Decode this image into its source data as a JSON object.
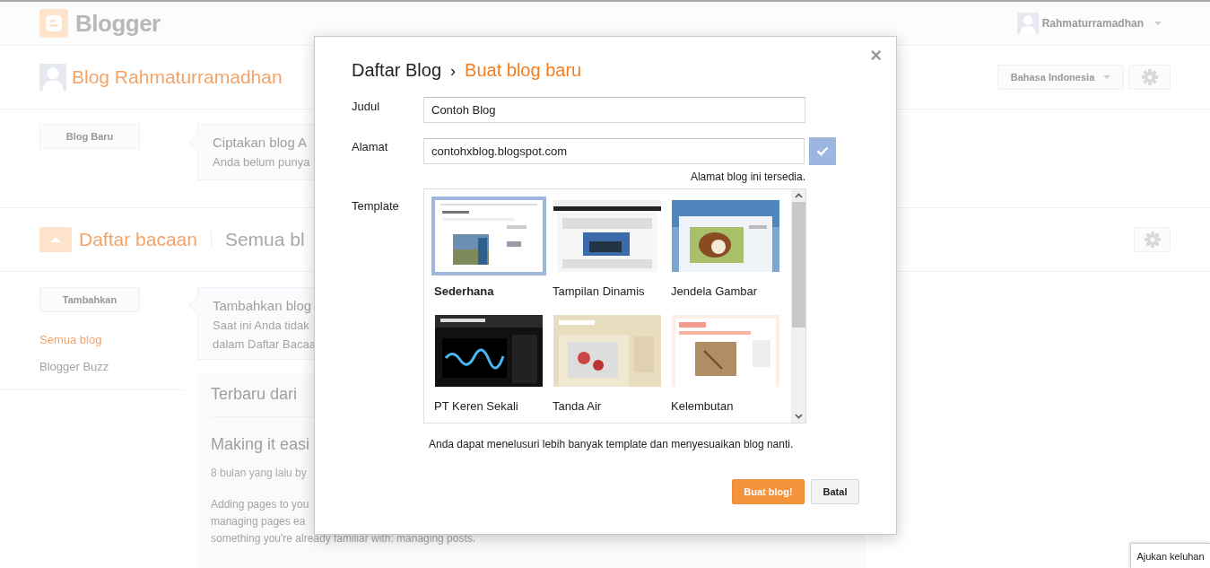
{
  "header": {
    "logo_text": "Blogger",
    "user_name": "Rahmaturramadhan"
  },
  "blog": {
    "title": "Blog Rahmaturramadhan",
    "language": "Bahasa Indonesia",
    "new_blog_button": "Blog Baru",
    "callout_title": "Ciptakan blog A",
    "callout_text": "Anda belum punya"
  },
  "reading_list": {
    "title": "Daftar bacaan",
    "subtitle": "Semua bl",
    "add_button": "Tambahkan",
    "callout_title": "Tambahkan blog",
    "callout_lines": [
      "Saat ini Anda tidak",
      "dalam Daftar Bacaa"
    ],
    "sidebar": {
      "items": [
        {
          "label": "Semua blog",
          "selected": true
        },
        {
          "label": "Blogger Buzz",
          "selected": false
        }
      ]
    },
    "latest": {
      "heading": "Terbaru dari",
      "post_title": "Making it easi",
      "meta": "8 bulan yang lalu by",
      "lines": [
        "Adding pages to you",
        "managing pages ea",
        "something you're already familiar with: managing posts."
      ]
    }
  },
  "dialog": {
    "breadcrumb": "Daftar Blog",
    "separator": "›",
    "title": "Buat blog baru",
    "close": "×",
    "fields": [
      {
        "label": "Judul",
        "value": "Contoh Blog",
        "verified": false
      },
      {
        "label": "Alamat",
        "value": "contohxblog.blogspot.com",
        "verified": true,
        "note": "Alamat blog ini tersedia."
      }
    ],
    "template_label": "Template",
    "templates": [
      {
        "name": "Sederhana",
        "selected": true,
        "kind": "simple"
      },
      {
        "name": "Tampilan Dinamis",
        "selected": false,
        "kind": "dynamic"
      },
      {
        "name": "Jendela Gambar",
        "selected": false,
        "kind": "window"
      },
      {
        "name": "PT Keren Sekali",
        "selected": false,
        "kind": "dark"
      },
      {
        "name": "Tanda Air",
        "selected": false,
        "kind": "watermark"
      },
      {
        "name": "Kelembutan",
        "selected": false,
        "kind": "ethereal"
      }
    ],
    "template_note": "Anda dapat menelusuri lebih banyak template dan menyesuaikan blog nanti.",
    "buttons": [
      {
        "label": "Buat blog!",
        "kind": "primary"
      },
      {
        "label": "Batal",
        "kind": "secondary"
      }
    ]
  },
  "feedback_button": "Ajukan keluhan"
}
